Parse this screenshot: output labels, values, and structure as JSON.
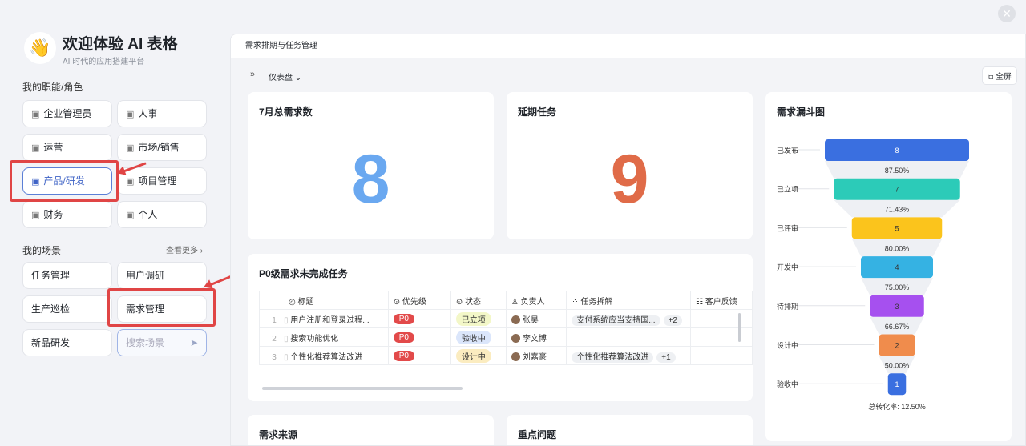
{
  "app": {
    "title": "欢迎体验 AI 表格",
    "subtitle": "AI 时代的应用搭建平台",
    "logo_icon": "waving-hand-icon"
  },
  "roles": {
    "heading": "我的职能/角色",
    "items": [
      {
        "label": "企业管理员",
        "icon": "building-icon"
      },
      {
        "label": "人事",
        "icon": "person-badge-icon"
      },
      {
        "label": "运营",
        "icon": "trophy-icon"
      },
      {
        "label": "市场/销售",
        "icon": "briefcase-icon"
      },
      {
        "label": "产品/研发",
        "icon": "recycle-icon",
        "selected": true
      },
      {
        "label": "项目管理",
        "icon": "folder-icon"
      },
      {
        "label": "财务",
        "icon": "yen-icon"
      },
      {
        "label": "个人",
        "icon": "user-icon"
      }
    ]
  },
  "scenes": {
    "heading": "我的场景",
    "more": "查看更多 ›",
    "items": [
      "任务管理",
      "用户调研",
      "生产巡检",
      "需求管理",
      "新品研发"
    ],
    "search_placeholder": "搜索场景"
  },
  "main": {
    "header": "需求排期与任务管理",
    "view": "仪表盘 ⌄",
    "fullscreen": "全屏"
  },
  "cards": {
    "total_title": "7月总需求数",
    "total_value": "8",
    "delayed_title": "延期任务",
    "delayed_value": "9",
    "funnel_title": "需求漏斗图",
    "p0_title": "P0级需求未完成任务",
    "source_title": "需求来源",
    "issues_title": "重点问题"
  },
  "table": {
    "headers": [
      "标题",
      "优先级",
      "状态",
      "负责人",
      "任务拆解",
      "客户反馈"
    ],
    "rows": [
      {
        "n": "1",
        "title": "用户注册和登录过程...",
        "priority": "P0",
        "status": "已立项",
        "status_color": "#f3f7c8",
        "owner": "张昊",
        "tasks": "支付系统应当支持国...",
        "more": "+2"
      },
      {
        "n": "2",
        "title": "搜索功能优化",
        "priority": "P0",
        "status": "验收中",
        "status_color": "#dbe6fb",
        "owner": "李文博",
        "tasks": "",
        "more": ""
      },
      {
        "n": "3",
        "title": "个性化推荐算法改进",
        "priority": "P0",
        "status": "设计中",
        "status_color": "#fbecc0",
        "owner": "刘嘉豪",
        "tasks": "个性化推荐算法改进",
        "more": "+1"
      }
    ]
  },
  "chart_data": {
    "type": "funnel",
    "title": "需求漏斗图",
    "categories": [
      "已发布",
      "已立项",
      "已评审",
      "开发中",
      "待排期",
      "设计中",
      "验收中"
    ],
    "values": [
      8,
      7,
      5,
      4,
      3,
      2,
      1
    ],
    "conversion": [
      "87.50%",
      "71.43%",
      "80.00%",
      "75.00%",
      "66.67%",
      "50.00%"
    ],
    "colors": [
      "#3a6fe0",
      "#2ccbb8",
      "#fbc41c",
      "#35b2e3",
      "#a650ef",
      "#f08c4c",
      "#3a6fe0"
    ],
    "total": "总转化率: 12.50%"
  }
}
